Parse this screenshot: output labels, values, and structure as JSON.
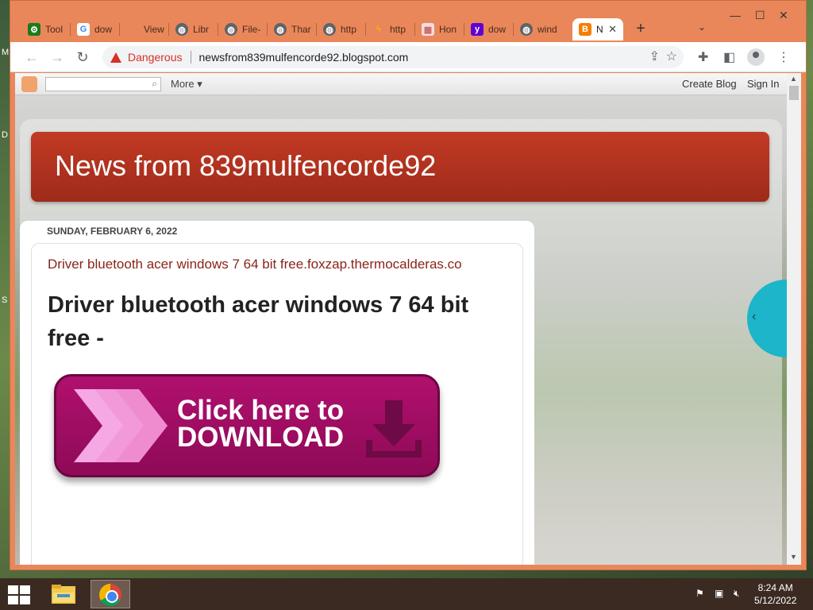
{
  "desktop": {
    "edge_letters": [
      "M",
      "D",
      "S"
    ]
  },
  "browser": {
    "tabs": [
      {
        "label": "Tool",
        "icon": "gear-icon",
        "color": "#1a7a1a"
      },
      {
        "label": "dow",
        "icon": "google-icon",
        "color": "#ffffff"
      },
      {
        "label": "View",
        "icon": "blank-icon",
        "color": "#e9875a"
      },
      {
        "label": "Libr",
        "icon": "globe-icon",
        "color": "#5f6368"
      },
      {
        "label": "File-",
        "icon": "globe-icon",
        "color": "#5f6368"
      },
      {
        "label": "Thar",
        "icon": "globe-icon",
        "color": "#5f6368"
      },
      {
        "label": "http",
        "icon": "globe-icon",
        "color": "#5f6368"
      },
      {
        "label": "http",
        "icon": "lightning-icon",
        "color": "#f4b400"
      },
      {
        "label": "Hon",
        "icon": "photo-icon",
        "color": "#cc6666"
      },
      {
        "label": "dow",
        "icon": "yahoo-icon",
        "color": "#6001d2"
      },
      {
        "label": "wind",
        "icon": "globe-icon",
        "color": "#5f6368"
      },
      {
        "label": "N",
        "icon": "blogger-icon",
        "color": "#f57d00"
      }
    ],
    "new_tab_symbol": "+",
    "tab_search_symbol": "⌄",
    "window_controls": {
      "minimize": "—",
      "maximize": "☐",
      "close": "✕"
    },
    "security_label": "Dangerous",
    "url": "newsfrom839mulfencorde92.blogspot.com"
  },
  "blogger_bar": {
    "more_label": "More ▾",
    "create_blog": "Create Blog",
    "sign_in": "Sign In"
  },
  "blog": {
    "header_title": "News from 839mulfencorde92",
    "post_date": "SUNDAY, FEBRUARY 6, 2022",
    "post_link": "Driver bluetooth acer windows 7 64 bit free.foxzap.thermocalderas.co",
    "post_title": "Driver bluetooth acer windows 7 64 bit free -",
    "download_line1": "Click here to",
    "download_line2": "DOWNLOAD",
    "side_arrow": "‹"
  },
  "taskbar": {
    "time": "8:24 AM",
    "date": "5/12/2022"
  }
}
